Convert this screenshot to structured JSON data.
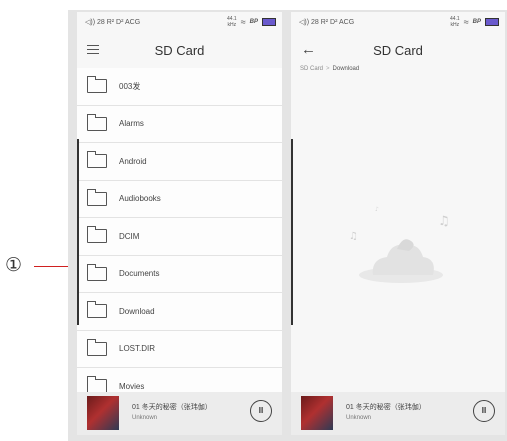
{
  "annotation": {
    "marker": "①"
  },
  "left_screen": {
    "status": {
      "left": "◁)) 28 R² D² ACG",
      "rate_top": "44.1",
      "rate_bottom": "kHz",
      "wifi": "wifi-icon",
      "brand": "BP",
      "battery": "battery-icon"
    },
    "title": "SD Card",
    "menu_icon": "hamburger-icon",
    "folders": [
      "003发",
      "Alarms",
      "Android",
      "Audiobooks",
      "DCIM",
      "Documents",
      "Download",
      "LOST.DIR",
      "Movies"
    ],
    "player": {
      "track": "01 冬天的秘密（张玮伽）",
      "artist": "Unknown",
      "button": "II"
    }
  },
  "right_screen": {
    "status": {
      "left": "◁)) 28 R² D² ACG",
      "rate_top": "44.1",
      "rate_bottom": "kHz",
      "wifi": "wifi-icon",
      "brand": "BP",
      "battery": "battery-icon"
    },
    "title": "SD Card",
    "back_icon": "arrow-left-icon",
    "breadcrumb": [
      "SD Card",
      "Download"
    ],
    "player": {
      "track": "01 冬天的秘密（张玮伽）",
      "artist": "Unknown",
      "button": "II"
    }
  }
}
